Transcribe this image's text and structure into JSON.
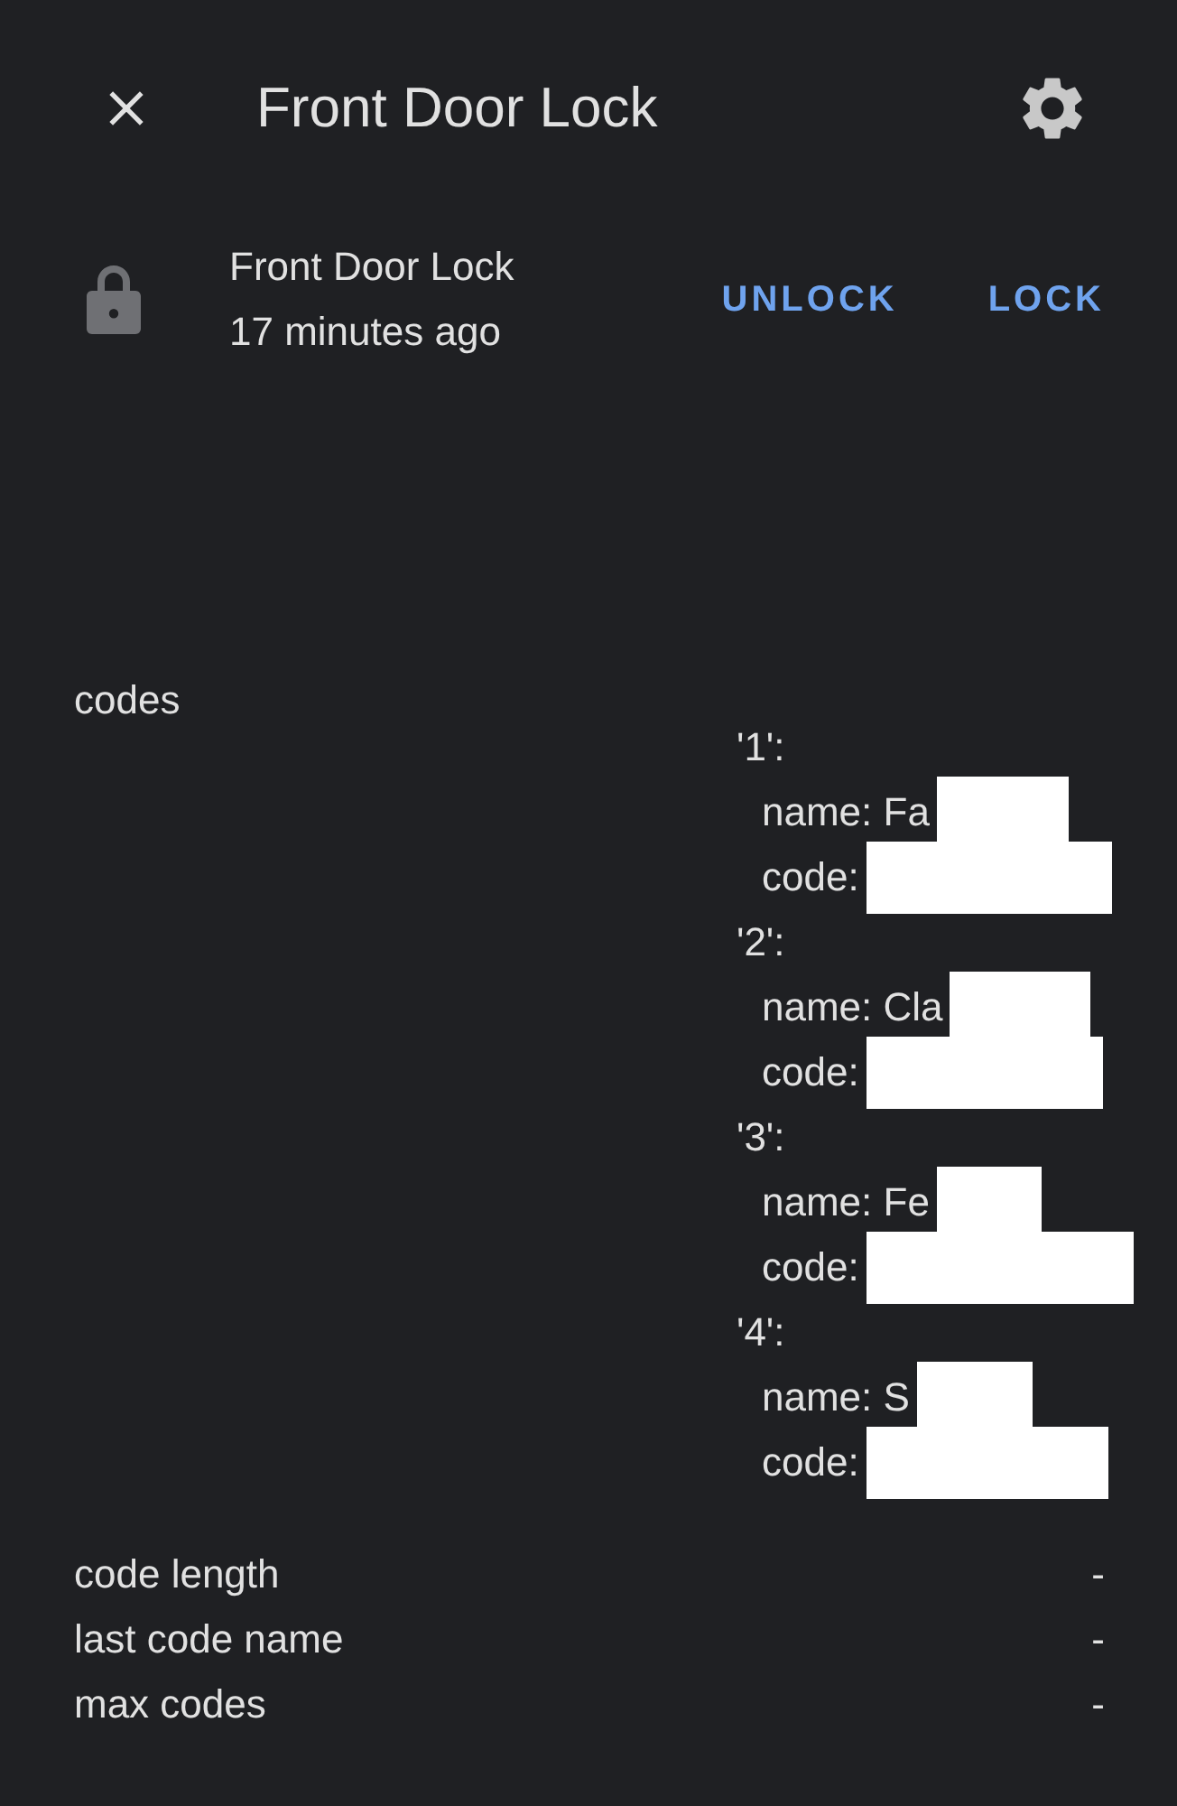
{
  "header": {
    "title": "Front Door Lock"
  },
  "entity": {
    "name": "Front Door Lock",
    "last_changed": "17 minutes ago",
    "buttons": [
      "UNLOCK",
      "LOCK"
    ]
  },
  "codes": {
    "label": "codes",
    "entries": [
      {
        "key": "'1':",
        "fields": [
          {
            "text": "name: Fa",
            "redacted": true
          },
          {
            "text": "code:",
            "redacted": true
          }
        ]
      },
      {
        "key": "'2':",
        "fields": [
          {
            "text": "name: Cla",
            "redacted": true
          },
          {
            "text": "code:",
            "redacted": true
          }
        ]
      },
      {
        "key": "'3':",
        "fields": [
          {
            "text": "name: Fe",
            "redacted": true
          },
          {
            "text": "code:",
            "redacted": true
          }
        ]
      },
      {
        "key": "'4':",
        "fields": [
          {
            "text": "name: S",
            "redacted": true
          },
          {
            "text": "code:",
            "redacted": true
          }
        ]
      }
    ]
  },
  "attributes": [
    {
      "label": "code length",
      "value": "-"
    },
    {
      "label": "last code name",
      "value": "-"
    },
    {
      "label": "max codes",
      "value": "-"
    }
  ]
}
